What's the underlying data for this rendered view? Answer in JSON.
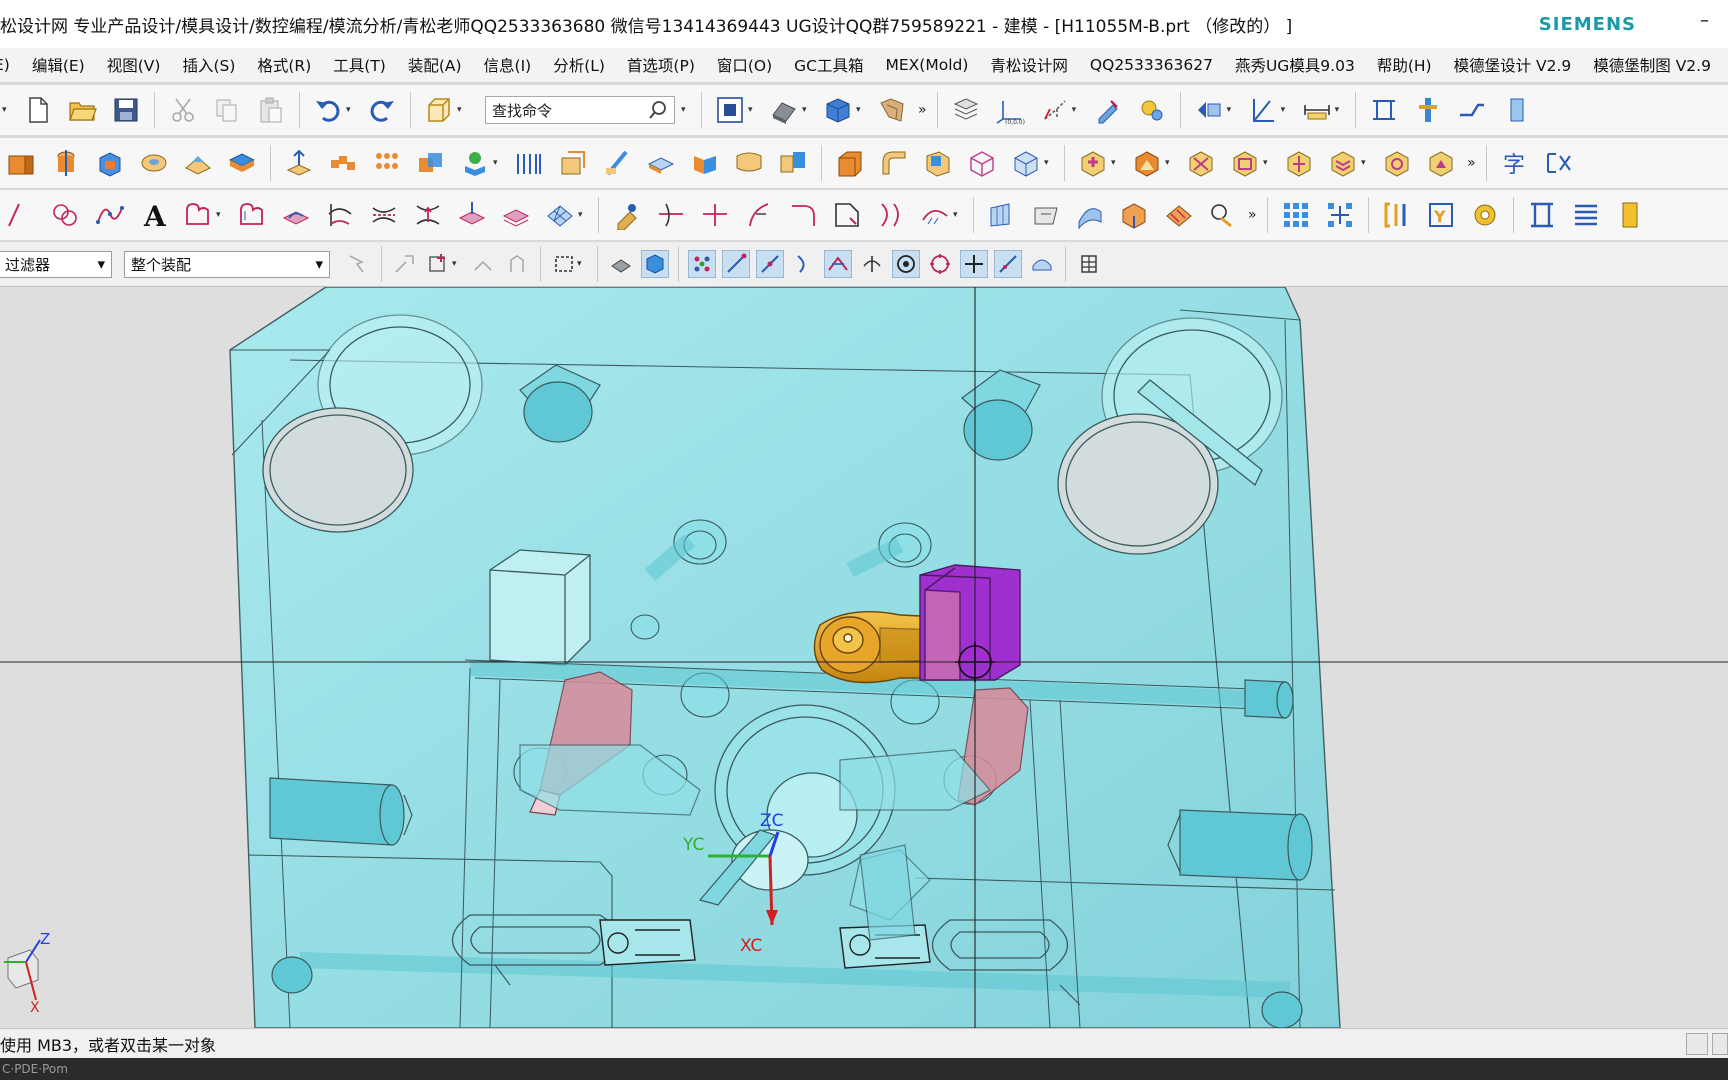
{
  "window": {
    "title": "松设计网 专业产品设计/模具设计/数控编程/模流分析/青松老师QQ2533363680 微信号13414369443 UG设计QQ群759589221 - 建模 - [H11055M-B.prt （修改的） ]",
    "brand": "SIEMENS",
    "minimize_glyph": "–"
  },
  "menu": [
    "E)",
    "编辑(E)",
    "视图(V)",
    "插入(S)",
    "格式(R)",
    "工具(T)",
    "装配(A)",
    "信息(I)",
    "分析(L)",
    "首选项(P)",
    "窗口(O)",
    "GC工具箱",
    "MEX(Mold)",
    "青松设计网",
    "QQ2533363627",
    "燕秀UG模具9.03",
    "帮助(H)",
    "模德堡设计 V2.9",
    "模德堡制图 V2.9"
  ],
  "toolbar": {
    "search_placeholder": "查找命令",
    "more_glyph": "»"
  },
  "filterbar": {
    "type_filter": "过滤器",
    "scope_filter": "整个装配"
  },
  "viewport": {
    "wcs_labels": {
      "y": "YC",
      "z": "ZC",
      "x": "XC"
    },
    "triad_labels": {
      "z": "Z",
      "x": "X"
    },
    "colors": {
      "plate": "#8fe0e6",
      "plate_edge": "#3a5a5e",
      "part_gold": "#e2a21a",
      "block_purple": "#a02fd0",
      "slider_red": "#d98a98",
      "crosshair": "#222222",
      "wcs_red": "#d02020",
      "wcs_green": "#30b030",
      "wcs_blue": "#2040e0"
    }
  },
  "status": {
    "message": "使用 MB3，或者双击某一对象",
    "taskbar_text": "C·PDE·Pom"
  }
}
